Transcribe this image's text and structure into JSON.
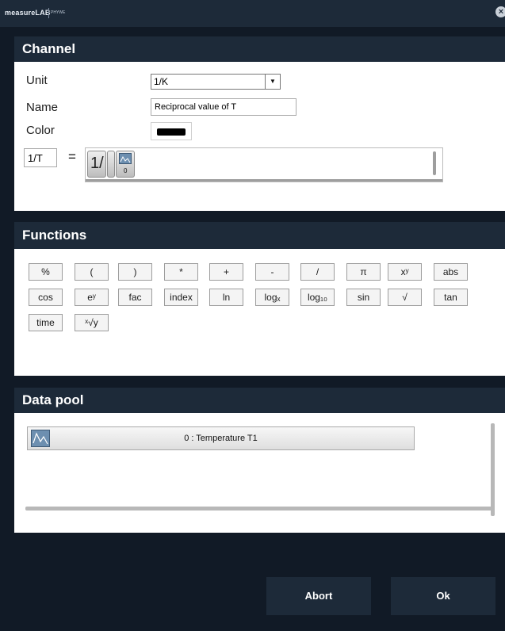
{
  "app": {
    "logo": "measureLAB",
    "logo_sub": "PHYWE",
    "close_symbol": "×"
  },
  "channel": {
    "heading": "Channel",
    "unit_label": "Unit",
    "unit_value": "1/K",
    "name_label": "Name",
    "name_value": "Reciprocal value of T",
    "color_label": "Color",
    "color_value": "#000000",
    "formula_name": "1/T",
    "equals": "=",
    "formula_tokens": [
      {
        "type": "text",
        "text": "1/"
      },
      {
        "type": "blank"
      },
      {
        "type": "channel",
        "icon": "chart-icon",
        "index": "0"
      }
    ]
  },
  "functions": {
    "heading": "Functions",
    "rows": [
      [
        "%",
        "(",
        ")",
        "*",
        "+",
        "-",
        "/",
        "π",
        "xʸ",
        "abs"
      ],
      [
        "cos",
        "eʸ",
        "fac",
        "index",
        "ln",
        "logₓ",
        "log₁₀",
        "sin",
        "√",
        "tan"
      ],
      [
        "time",
        "ˣ√y"
      ]
    ]
  },
  "data_pool": {
    "heading": "Data pool",
    "items": [
      {
        "icon": "chart-icon",
        "label": "0 : Temperature T1"
      }
    ]
  },
  "footer": {
    "abort_label": "Abort",
    "ok_label": "Ok"
  },
  "colors": {
    "chrome": "#1d2a39",
    "background": "#111a26",
    "panel": "#ffffff",
    "icon_blue": "#6d8fb0"
  }
}
